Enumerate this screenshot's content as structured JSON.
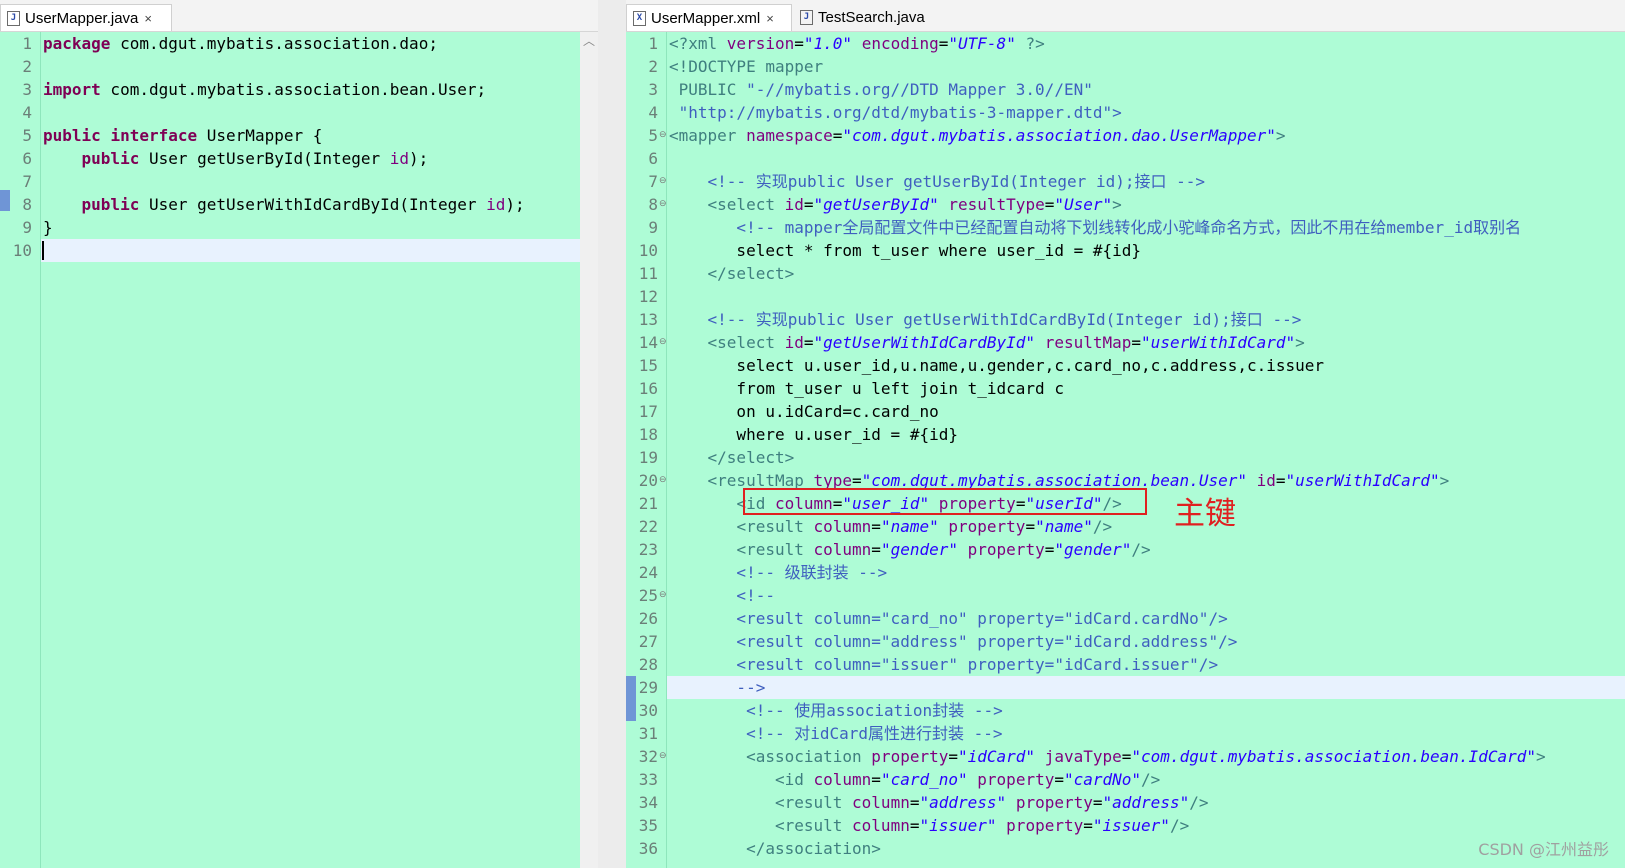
{
  "left_editor": {
    "tab_label": "UserMapper.java",
    "tab_close": "×",
    "tab_icon": "J",
    "lines": [
      [
        {
          "t": "package",
          "c": "kw"
        },
        {
          "t": " com.dgut.mybatis.association.dao;"
        }
      ],
      [],
      [
        {
          "t": "import",
          "c": "kw"
        },
        {
          "t": " com.dgut.mybatis.association.bean.User;"
        }
      ],
      [],
      [
        {
          "t": "public",
          "c": "kw"
        },
        {
          "t": " "
        },
        {
          "t": "interface",
          "c": "kw"
        },
        {
          "t": " UserMapper {"
        }
      ],
      [
        {
          "t": "    "
        },
        {
          "t": "public",
          "c": "kw"
        },
        {
          "t": " User getUserById(Integer "
        },
        {
          "t": "id",
          "c": "at"
        },
        {
          "t": ");"
        }
      ],
      [],
      [
        {
          "t": "    "
        },
        {
          "t": "public",
          "c": "kw"
        },
        {
          "t": " User getUserWithIdCardById(Integer "
        },
        {
          "t": "id",
          "c": "at"
        },
        {
          "t": ");"
        }
      ],
      [
        {
          "t": "}"
        }
      ],
      []
    ]
  },
  "right_editor": {
    "tabs": [
      {
        "label": "UserMapper.xml",
        "icon": "X",
        "close": "×",
        "active": true
      },
      {
        "label": "TestSearch.java",
        "icon": "J",
        "close": "",
        "active": false
      }
    ],
    "fold_marker": "⊖",
    "lines": [
      [
        {
          "t": "<?xml ",
          "c": "pi"
        },
        {
          "t": "version",
          "c": "at"
        },
        {
          "t": "="
        },
        {
          "t": "\"1.0\"",
          "c": "st"
        },
        {
          "t": " "
        },
        {
          "t": "encoding",
          "c": "at"
        },
        {
          "t": "="
        },
        {
          "t": "\"UTF-8\"",
          "c": "st"
        },
        {
          "t": " ?>",
          "c": "pi"
        }
      ],
      [
        {
          "t": "<!DOCTYPE mapper",
          "c": "tg"
        }
      ],
      [
        {
          "t": " PUBLIC ",
          "c": "tg"
        },
        {
          "t": "\"-//mybatis.org//DTD Mapper 3.0//EN\"",
          "c": "cm"
        }
      ],
      [
        {
          "t": " \"http://mybatis.org/dtd/mybatis-3-mapper.dtd\">",
          "c": "cm"
        }
      ],
      [
        {
          "t": "<mapper ",
          "c": "tg"
        },
        {
          "t": "namespace",
          "c": "at"
        },
        {
          "t": "="
        },
        {
          "t": "\"com.dgut.mybatis.association.dao.UserMapper\"",
          "c": "st"
        },
        {
          "t": ">",
          "c": "tg"
        }
      ],
      [],
      [
        {
          "t": "    <!-- 实现public User getUserById(Integer id);接口 -->",
          "c": "cm"
        }
      ],
      [
        {
          "t": "    "
        },
        {
          "t": "<select ",
          "c": "tg"
        },
        {
          "t": "id",
          "c": "at"
        },
        {
          "t": "="
        },
        {
          "t": "\"getUserById\"",
          "c": "st"
        },
        {
          "t": " "
        },
        {
          "t": "resultType",
          "c": "at"
        },
        {
          "t": "="
        },
        {
          "t": "\"User\"",
          "c": "st"
        },
        {
          "t": ">",
          "c": "tg"
        }
      ],
      [
        {
          "t": "       <!-- mapper全局配置文件中已经配置自动将下划线转化成小驼峰命名方式，因此不用在给member_id取别名",
          "c": "cm"
        }
      ],
      [
        {
          "t": "       select * from t_user where user_id = #{id}"
        }
      ],
      [
        {
          "t": "    "
        },
        {
          "t": "</select>",
          "c": "tg"
        }
      ],
      [],
      [
        {
          "t": "    <!-- 实现public User getUserWithIdCardById(Integer id);接口 -->",
          "c": "cm"
        }
      ],
      [
        {
          "t": "    "
        },
        {
          "t": "<select ",
          "c": "tg"
        },
        {
          "t": "id",
          "c": "at"
        },
        {
          "t": "="
        },
        {
          "t": "\"getUserWithIdCardById\"",
          "c": "st"
        },
        {
          "t": " "
        },
        {
          "t": "resultMap",
          "c": "at"
        },
        {
          "t": "="
        },
        {
          "t": "\"userWithIdCard\"",
          "c": "st"
        },
        {
          "t": ">",
          "c": "tg"
        }
      ],
      [
        {
          "t": "       select u.user_id,u.name,u.gender,c.card_no,c.address,c.issuer"
        }
      ],
      [
        {
          "t": "       from t_user u left join t_idcard c"
        }
      ],
      [
        {
          "t": "       on u.idCard=c.card_no"
        }
      ],
      [
        {
          "t": "       where u.user_id = #{id}"
        }
      ],
      [
        {
          "t": "    "
        },
        {
          "t": "</select>",
          "c": "tg"
        }
      ],
      [
        {
          "t": "    "
        },
        {
          "t": "<resultMap ",
          "c": "tg"
        },
        {
          "t": "type",
          "c": "at"
        },
        {
          "t": "="
        },
        {
          "t": "\"com.dgut.mybatis.association.bean.User\"",
          "c": "st"
        },
        {
          "t": " "
        },
        {
          "t": "id",
          "c": "at"
        },
        {
          "t": "="
        },
        {
          "t": "\"userWithIdCard\"",
          "c": "st"
        },
        {
          "t": ">",
          "c": "tg"
        }
      ],
      [
        {
          "t": "       "
        },
        {
          "t": "<id ",
          "c": "tg"
        },
        {
          "t": "column",
          "c": "at"
        },
        {
          "t": "="
        },
        {
          "t": "\"user_id\"",
          "c": "st"
        },
        {
          "t": " "
        },
        {
          "t": "property",
          "c": "at"
        },
        {
          "t": "="
        },
        {
          "t": "\"userId\"",
          "c": "st"
        },
        {
          "t": "/>",
          "c": "tg"
        }
      ],
      [
        {
          "t": "       "
        },
        {
          "t": "<result ",
          "c": "tg"
        },
        {
          "t": "column",
          "c": "at"
        },
        {
          "t": "="
        },
        {
          "t": "\"name\"",
          "c": "st"
        },
        {
          "t": " "
        },
        {
          "t": "property",
          "c": "at"
        },
        {
          "t": "="
        },
        {
          "t": "\"name\"",
          "c": "st"
        },
        {
          "t": "/>",
          "c": "tg"
        }
      ],
      [
        {
          "t": "       "
        },
        {
          "t": "<result ",
          "c": "tg"
        },
        {
          "t": "column",
          "c": "at"
        },
        {
          "t": "="
        },
        {
          "t": "\"gender\"",
          "c": "st"
        },
        {
          "t": " "
        },
        {
          "t": "property",
          "c": "at"
        },
        {
          "t": "="
        },
        {
          "t": "\"gender\"",
          "c": "st"
        },
        {
          "t": "/>",
          "c": "tg"
        }
      ],
      [
        {
          "t": "       <!-- 级联封装 -->",
          "c": "cm"
        }
      ],
      [
        {
          "t": "       <!--",
          "c": "cm"
        }
      ],
      [
        {
          "t": "       <result column=\"card_no\" property=\"idCard.cardNo\"/>",
          "c": "cm"
        }
      ],
      [
        {
          "t": "       <result column=\"address\" property=\"idCard.address\"/>",
          "c": "cm"
        }
      ],
      [
        {
          "t": "       <result column=\"issuer\" property=\"idCard.issuer\"/>",
          "c": "cm"
        }
      ],
      [
        {
          "t": "       -->",
          "c": "cm"
        }
      ],
      [
        {
          "t": "        <!-- 使用association封装 -->",
          "c": "cm"
        }
      ],
      [
        {
          "t": "        <!-- 对idCard属性进行封装 -->",
          "c": "cm"
        }
      ],
      [
        {
          "t": "        "
        },
        {
          "t": "<association ",
          "c": "tg"
        },
        {
          "t": "property",
          "c": "at"
        },
        {
          "t": "="
        },
        {
          "t": "\"idCard\"",
          "c": "st"
        },
        {
          "t": " "
        },
        {
          "t": "javaType",
          "c": "at"
        },
        {
          "t": "="
        },
        {
          "t": "\"com.dgut.mybatis.association.bean.IdCard\"",
          "c": "st"
        },
        {
          "t": ">",
          "c": "tg"
        }
      ],
      [
        {
          "t": "           "
        },
        {
          "t": "<id ",
          "c": "tg"
        },
        {
          "t": "column",
          "c": "at"
        },
        {
          "t": "="
        },
        {
          "t": "\"card_no\"",
          "c": "st"
        },
        {
          "t": " "
        },
        {
          "t": "property",
          "c": "at"
        },
        {
          "t": "="
        },
        {
          "t": "\"cardNo\"",
          "c": "st"
        },
        {
          "t": "/>",
          "c": "tg"
        }
      ],
      [
        {
          "t": "           "
        },
        {
          "t": "<result ",
          "c": "tg"
        },
        {
          "t": "column",
          "c": "at"
        },
        {
          "t": "="
        },
        {
          "t": "\"address\"",
          "c": "st"
        },
        {
          "t": " "
        },
        {
          "t": "property",
          "c": "at"
        },
        {
          "t": "="
        },
        {
          "t": "\"address\"",
          "c": "st"
        },
        {
          "t": "/>",
          "c": "tg"
        }
      ],
      [
        {
          "t": "           "
        },
        {
          "t": "<result ",
          "c": "tg"
        },
        {
          "t": "column",
          "c": "at"
        },
        {
          "t": "="
        },
        {
          "t": "\"issuer\"",
          "c": "st"
        },
        {
          "t": " "
        },
        {
          "t": "property",
          "c": "at"
        },
        {
          "t": "="
        },
        {
          "t": "\"issuer\"",
          "c": "st"
        },
        {
          "t": "/>",
          "c": "tg"
        }
      ],
      [
        {
          "t": "        "
        },
        {
          "t": "</association>",
          "c": "tg"
        }
      ]
    ]
  },
  "annotation": {
    "label": "主键",
    "color": "#e02020"
  },
  "watermark": "CSDN @江州益彤",
  "colors": {
    "editor_bg": "#aefcd6",
    "keyword": "#7f0055",
    "string": "#2a00ff",
    "comment": "#3f5fbf",
    "tag": "#3f7f7f",
    "attribute": "#7f007f"
  }
}
